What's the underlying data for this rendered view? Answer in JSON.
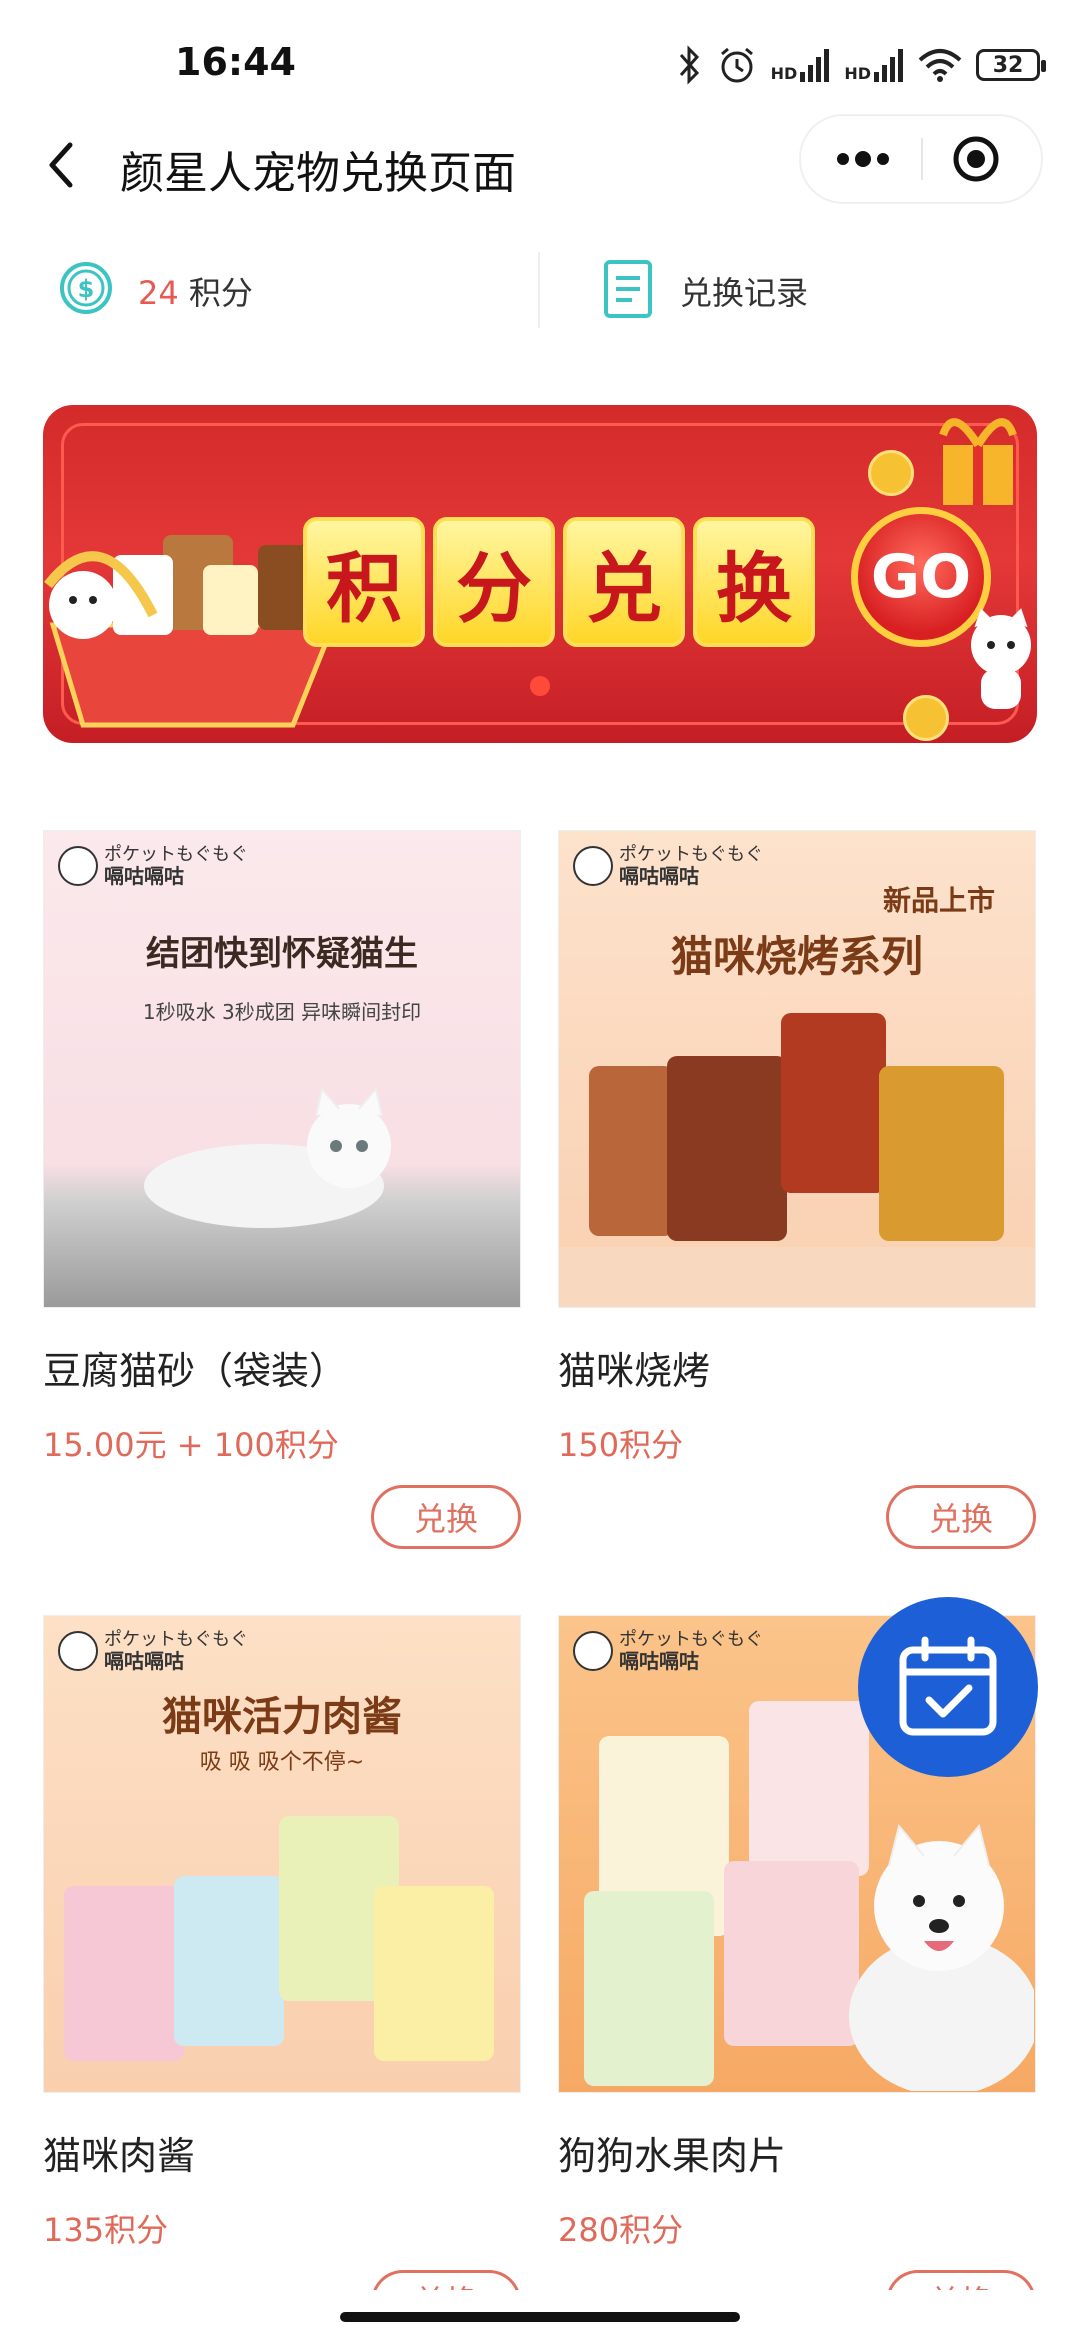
{
  "status_bar": {
    "time": "16:44",
    "hd1": "HD",
    "hd2": "HD",
    "battery": "32",
    "icons": [
      "bluetooth-icon",
      "alarm-icon",
      "signal-icon",
      "signal-icon",
      "wifi-icon",
      "battery-icon"
    ]
  },
  "nav": {
    "title": "颜星人宠物兑换页面",
    "back_icon": "back-arrow-icon",
    "more_icon": "more-dots-icon",
    "close_icon": "miniprogram-close-icon"
  },
  "points_bar": {
    "points_value": "24",
    "points_label": "积分",
    "record_label": "兑换记录",
    "coin_icon": "coin-icon",
    "record_icon": "document-icon"
  },
  "banner": {
    "tiles": [
      "积",
      "分",
      "兑",
      "换"
    ],
    "go_label": "GO",
    "active_slide": 1
  },
  "products": [
    {
      "name": "豆腐猫砂（袋装）",
      "price": "15.00元 + 100积分",
      "button": "兑换",
      "image": {
        "brand_top": "ポケットもぐもぐ",
        "brand_name": "嗝咕嗝咕",
        "headline": "结团快到怀疑猫生",
        "sub": "1秒吸水  3秒成团 异味瞬间封印"
      }
    },
    {
      "name": "猫咪烧烤",
      "price": "150积分",
      "button": "兑换",
      "image": {
        "brand_top": "ポケットもぐもぐ",
        "brand_name": "嗝咕嗝咕",
        "tag": "新品上市",
        "headline": "猫咪烧烤系列"
      }
    },
    {
      "name": "猫咪肉酱",
      "price": "135积分",
      "button": "兑换",
      "image": {
        "brand_top": "ポケットもぐもぐ",
        "brand_name": "嗝咕嗝咕",
        "headline": "猫咪活力肉酱",
        "sub": "吸 吸 吸个不停~"
      }
    },
    {
      "name": "狗狗水果肉片",
      "price": "280积分",
      "button": "兑换",
      "image": {
        "brand_top": "ポケットもぐもぐ",
        "brand_name": "嗝咕嗝咕"
      }
    }
  ],
  "fab_icon": "calendar-check-icon",
  "colors": {
    "accent": "#e06a5a",
    "banner_red": "#d32a2a",
    "fab_blue": "#1d5fd6",
    "teal": "#3cc4c4"
  }
}
